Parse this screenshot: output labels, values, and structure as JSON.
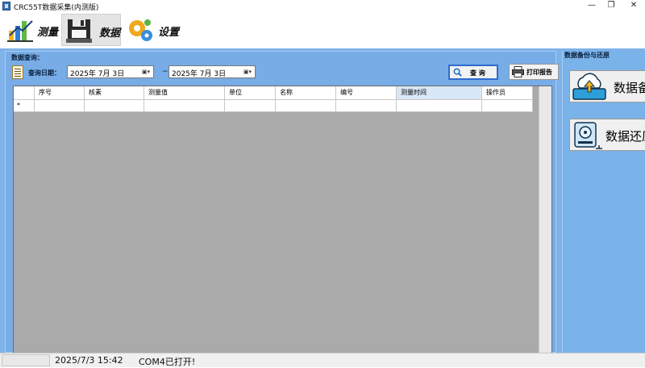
{
  "window": {
    "title": "CRC55T数据采集(内测版)",
    "controls": {
      "minimize": "—",
      "maximize": "❐",
      "close": "✕"
    }
  },
  "toolbar": {
    "items": [
      {
        "label": "测量",
        "icon": "chart-icon",
        "active": false
      },
      {
        "label": "数据",
        "icon": "floppy-icon",
        "active": true
      },
      {
        "label": "设置",
        "icon": "gears-icon",
        "active": false
      }
    ]
  },
  "query": {
    "group_title": "数据查询：",
    "date_label": "查询日期：",
    "start_date": "2025年  7月  3日",
    "end_date": "2025年  7月  3日",
    "separator": "~",
    "query_button": "查 询",
    "print_button": "打印报告"
  },
  "grid": {
    "columns": [
      "序号",
      "核素",
      "测量值",
      "单位",
      "名称",
      "编号",
      "测量时间",
      "操作员"
    ],
    "selected_column": "测量时间",
    "new_row_marker": "*",
    "rows": []
  },
  "backup": {
    "group_title": "数据备份与还原",
    "backup_button": "数据备",
    "restore_button": "数据还原"
  },
  "status": {
    "datetime": "2025/7/3 15:42",
    "port_status": "COM4已打开!"
  },
  "colors": {
    "main_background": "#7fb2e8",
    "grid_background": "#aaaaaa",
    "query_button_border": "#2f6ccf"
  }
}
